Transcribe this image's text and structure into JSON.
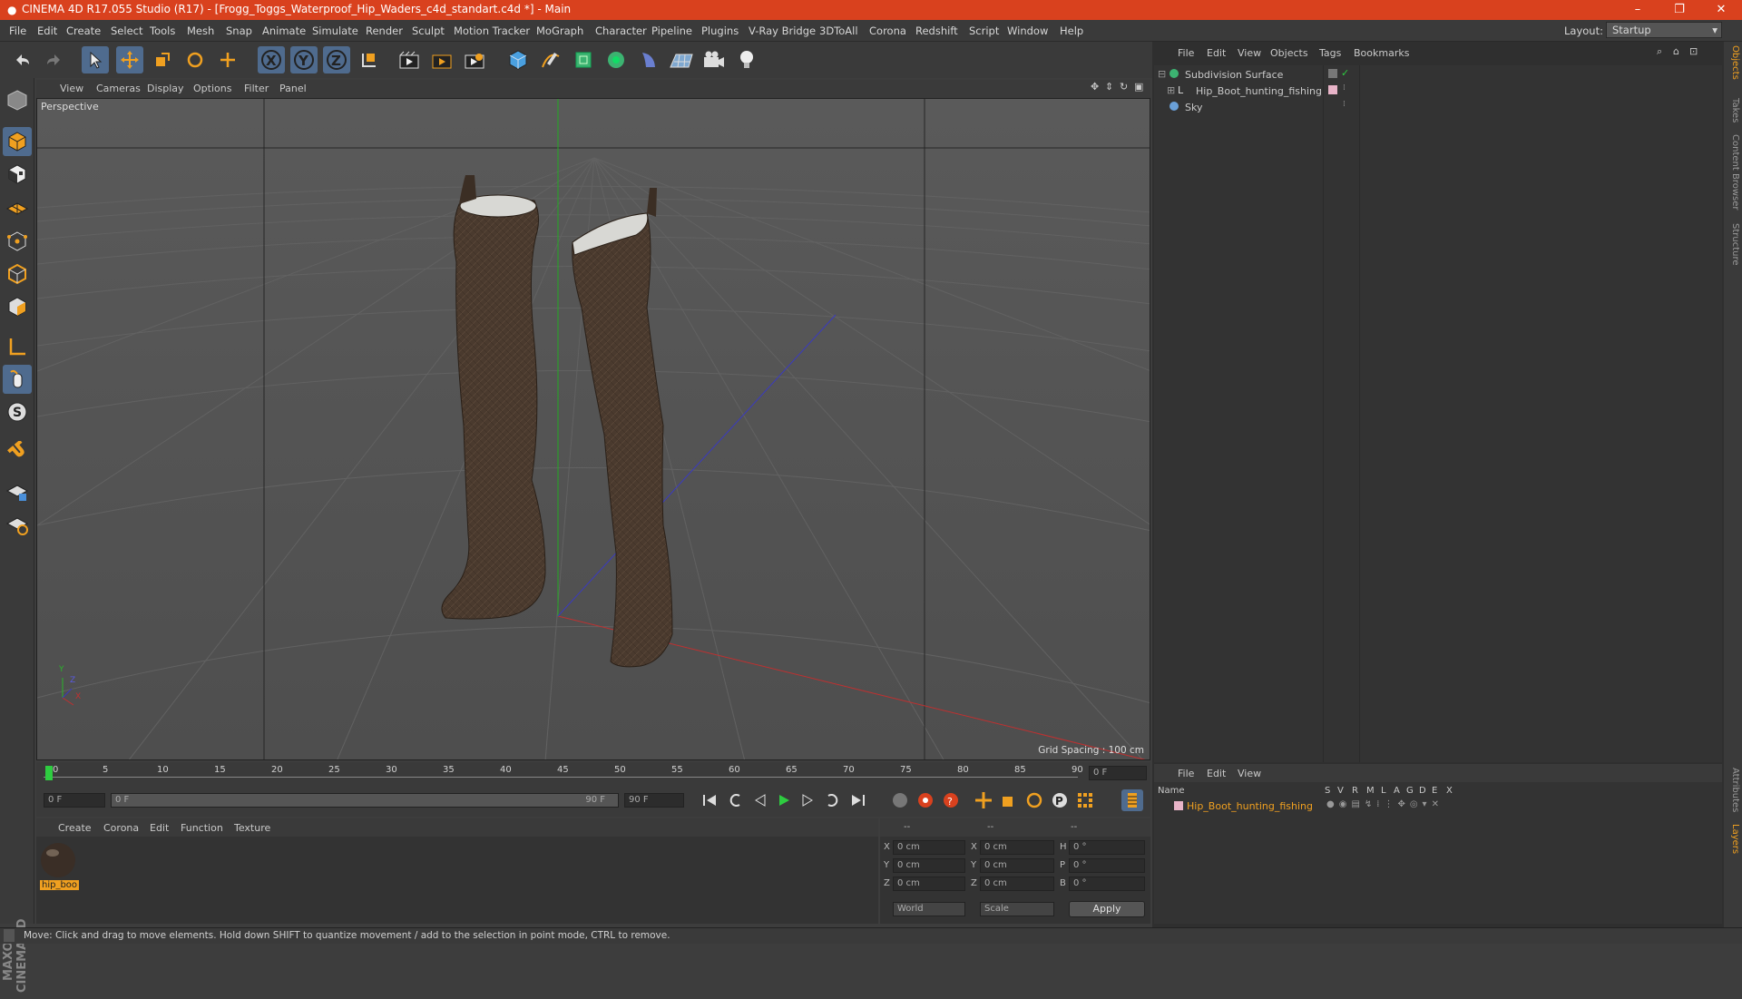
{
  "window": {
    "title": "CINEMA 4D R17.055 Studio (R17) - [Frogg_Toggs_Waterproof_Hip_Waders_c4d_standart.c4d *] - Main",
    "minimize": "–",
    "maximize": "❐",
    "close": "✕"
  },
  "menubar": {
    "items": [
      "File",
      "Edit",
      "Create",
      "Select",
      "Tools",
      "Mesh",
      "Snap",
      "Animate",
      "Simulate",
      "Render",
      "Sculpt",
      "Motion Tracker",
      "MoGraph",
      "Character",
      "Pipeline",
      "Plugins",
      "V-Ray Bridge",
      "3DToAll",
      "Corona",
      "Redshift",
      "Script",
      "Window",
      "Help"
    ],
    "layout_label": "Layout:",
    "layout_value": "Startup"
  },
  "viewport": {
    "menu": [
      "View",
      "Cameras",
      "Display",
      "Options",
      "Filter",
      "Panel"
    ],
    "camera_label": "Perspective",
    "grid_spacing": "Grid Spacing : 100 cm",
    "axis_y": "Y",
    "axis_z": "Z",
    "axis_x": "X"
  },
  "object_manager": {
    "menu": [
      "File",
      "Edit",
      "View",
      "Objects",
      "Tags",
      "Bookmarks"
    ],
    "objects": [
      {
        "name": "Subdivision Surface"
      },
      {
        "name": "Hip_Boot_hunting_fishing"
      },
      {
        "name": "Sky"
      }
    ]
  },
  "right_tabs": [
    "Objects",
    "Takes",
    "Content Browser",
    "Structure"
  ],
  "right_tabs_bottom": [
    "Attributes",
    "Layers"
  ],
  "timeline": {
    "ticks": [
      "0",
      "5",
      "10",
      "15",
      "20",
      "25",
      "30",
      "35",
      "40",
      "45",
      "50",
      "55",
      "60",
      "65",
      "70",
      "75",
      "80",
      "85",
      "90"
    ],
    "end_field": "0 F"
  },
  "playback": {
    "start": "0 F",
    "range_start": "0 F",
    "range_end": "90 F",
    "end": "90 F"
  },
  "material_manager": {
    "menu": [
      "Create",
      "Corona",
      "Edit",
      "Function",
      "Texture"
    ],
    "material_name": "hip_boo"
  },
  "coords": {
    "headers": [
      "--",
      "--",
      "--"
    ],
    "rows": [
      {
        "a": "X",
        "av": "0 cm",
        "b": "X",
        "bv": "0 cm",
        "c": "H",
        "cv": "0 °"
      },
      {
        "a": "Y",
        "av": "0 cm",
        "b": "Y",
        "bv": "0 cm",
        "c": "P",
        "cv": "0 °"
      },
      {
        "a": "Z",
        "av": "0 cm",
        "b": "Z",
        "bv": "0 cm",
        "c": "B",
        "cv": "0 °"
      }
    ],
    "space": "World",
    "mode": "Scale",
    "apply": "Apply"
  },
  "layer_manager": {
    "menu": [
      "File",
      "Edit",
      "View"
    ],
    "columns": [
      "Name",
      "S",
      "V",
      "R",
      "M",
      "L",
      "A",
      "G",
      "D",
      "E",
      "X"
    ],
    "row": "Hip_Boot_hunting_fishing"
  },
  "status": "Move: Click and drag to move elements. Hold down SHIFT to quantize movement / add to the selection in point mode, CTRL to remove.",
  "brand": "MAXON CINEMA 4D",
  "colors": {
    "title": "#d9411e",
    "highlight": "#4f6b8e",
    "accent": "#f0a020"
  }
}
